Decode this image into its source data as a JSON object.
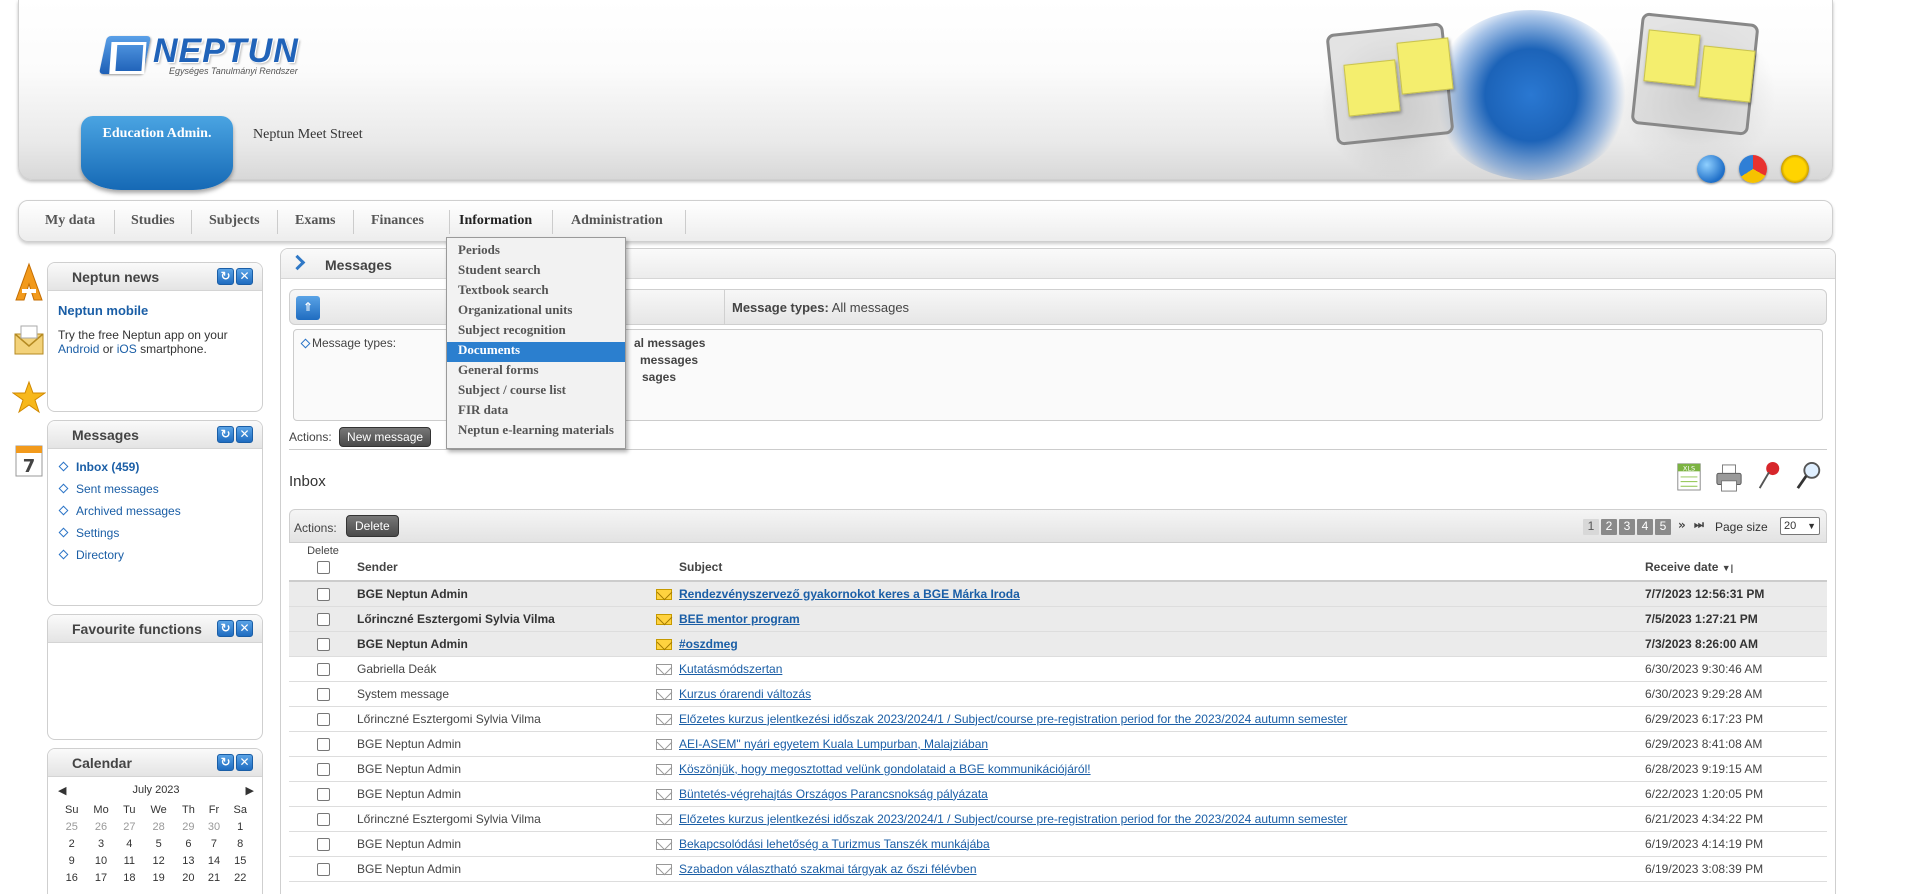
{
  "header": {
    "logo_text": "NEPTUN",
    "logo_sub": "Egységes Tanulmányi Rendszer",
    "edu_tab": "Education Admin.",
    "meet_street": "Neptun Meet Street"
  },
  "nav": {
    "items": [
      "My data",
      "Studies",
      "Subjects",
      "Exams",
      "Finances",
      "Information",
      "Administration"
    ]
  },
  "dropdown": {
    "items": [
      "Periods",
      "Student search",
      "Textbook search",
      "Organizational units",
      "Subject recognition",
      "Documents",
      "General forms",
      "Subject / course list",
      "FIR data",
      "Neptun e-learning materials"
    ],
    "active_index": 5
  },
  "news": {
    "title": "Neptun news",
    "heading": "Neptun mobile",
    "text_1": "Try the free Neptun app on your",
    "android": "Android",
    "or": "or",
    "ios": "iOS",
    "text_2": "smartphone."
  },
  "messages_panel": {
    "title": "Messages",
    "links": [
      "Inbox (459)",
      "Sent messages",
      "Archived messages",
      "Settings",
      "Directory"
    ]
  },
  "favourites": {
    "title": "Favourite functions"
  },
  "calendar": {
    "title": "Calendar",
    "month": "July 2023",
    "days": [
      "Su",
      "Mo",
      "Tu",
      "We",
      "Th",
      "Fr",
      "Sa"
    ],
    "weeks": [
      [
        "25",
        "26",
        "27",
        "28",
        "29",
        "30",
        "1"
      ],
      [
        "2",
        "3",
        "4",
        "5",
        "6",
        "7",
        "8"
      ],
      [
        "9",
        "10",
        "11",
        "12",
        "13",
        "14",
        "15"
      ],
      [
        "16",
        "17",
        "18",
        "19",
        "20",
        "21",
        "22"
      ]
    ]
  },
  "content": {
    "title": "Messages",
    "filter_label": "Message types:",
    "filter_value": "All messages",
    "filter_box_label": "Message types:",
    "filter_opts": [
      "al messages",
      "messages",
      "sages"
    ],
    "actions_label": "Actions:",
    "new_message": "New message",
    "inbox_title": "Inbox"
  },
  "grid": {
    "actions_label": "Actions:",
    "delete_btn": "Delete",
    "pages": [
      "1",
      "2",
      "3",
      "4",
      "5"
    ],
    "page_size_label": "Page size",
    "page_size_value": "20",
    "headers": {
      "delete": "Delete",
      "sender": "Sender",
      "subject": "Subject",
      "date": "Receive date"
    },
    "rows": [
      {
        "sender": "BGE Neptun Admin",
        "subject": "Rendezvényszervező gyakornokot keres a BGE Márka Iroda",
        "date": "7/7/2023 12:56:31 PM",
        "unread": true
      },
      {
        "sender": "Lőrinczné Esztergomi Sylvia Vilma",
        "subject": "BEE mentor program",
        "date": "7/5/2023 1:27:21 PM",
        "unread": true
      },
      {
        "sender": "BGE Neptun Admin",
        "subject": "#oszdmeg",
        "date": "7/3/2023 8:26:00 AM",
        "unread": true
      },
      {
        "sender": "Gabriella Deák",
        "subject": "Kutatásmódszertan",
        "date": "6/30/2023 9:30:46 AM",
        "unread": false
      },
      {
        "sender": "System message",
        "subject": "Kurzus órarendi változás",
        "date": "6/30/2023 9:29:28 AM",
        "unread": false
      },
      {
        "sender": "Lőrinczné Esztergomi Sylvia Vilma",
        "subject": "Előzetes kurzus jelentkezési időszak 2023/2024/1 / Subject/course pre-registration period for the 2023/2024 autumn semester",
        "date": "6/29/2023 6:17:23 PM",
        "unread": false
      },
      {
        "sender": "BGE Neptun Admin",
        "subject": "AEI-ASEM\" nyári egyetem Kuala Lumpurban, Malajziában",
        "date": "6/29/2023 8:41:08 AM",
        "unread": false
      },
      {
        "sender": "BGE Neptun Admin",
        "subject": "Köszönjük, hogy megosztottad velünk gondolataid a BGE kommunikációjáról!",
        "date": "6/28/2023 9:19:15 AM",
        "unread": false
      },
      {
        "sender": "BGE Neptun Admin",
        "subject": "Büntetés-végrehajtás Országos Parancsnokság pályázata",
        "date": "6/22/2023 1:20:05 PM",
        "unread": false
      },
      {
        "sender": "Lőrinczné Esztergomi Sylvia Vilma",
        "subject": "Előzetes kurzus jelentkezési időszak 2023/2024/1 / Subject/course pre-registration period for the 2023/2024 autumn semester",
        "date": "6/21/2023 4:34:22 PM",
        "unread": false
      },
      {
        "sender": "BGE Neptun Admin",
        "subject": "Bekapcsolódási lehetőség a Turizmus Tanszék munkájába",
        "date": "6/19/2023 4:14:19 PM",
        "unread": false
      },
      {
        "sender": "BGE Neptun Admin",
        "subject": "Szabadon választható szakmai tárgyak az őszi félévben",
        "date": "6/19/2023 3:08:39 PM",
        "unread": false
      }
    ]
  },
  "colors": {
    "brand_blue": "#1d6ec4",
    "link": "#1a5ea6",
    "active_menu": "#2b7fcf"
  }
}
